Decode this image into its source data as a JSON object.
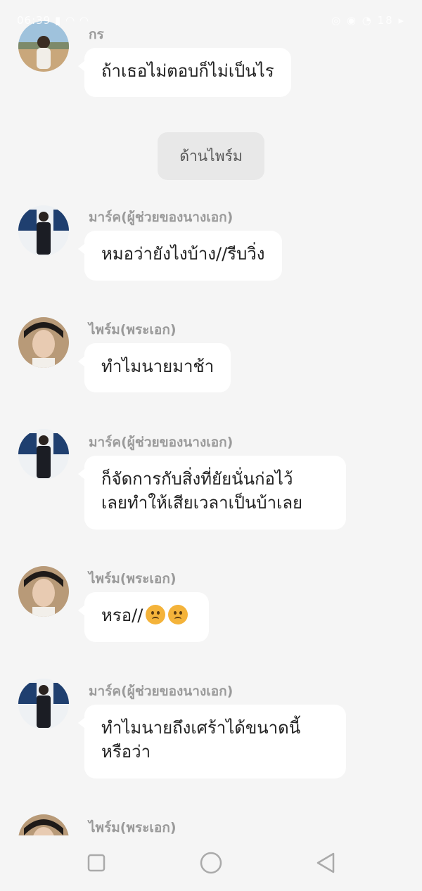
{
  "status_bar": {
    "left_text": "06:39 ▮ ◠ ◠",
    "right_text": "◎ ◉ ◔ 18 ▸"
  },
  "narration": {
    "label": "ด้านไพร์ม"
  },
  "messages": [
    {
      "sender": "กร",
      "text": "ถ้าเธอไม่ตอบก็ไม่เป็นไร"
    },
    {
      "sender": "มาร์ค(ผู้ช่วยของนางเอก)",
      "text": "หมอว่ายังไงบ้าง//รีบวิ่ง"
    },
    {
      "sender": "ไพร์ม(พระเอก)",
      "text": "ทำไมนายมาช้า"
    },
    {
      "sender": "มาร์ค(ผู้ช่วยของนางเอก)",
      "line1": "ก็จัดการกับสิ่งที่ยัยนั่นก่อไว้",
      "line2": "เลยทำให้เสียเวลาเป็นบ้าเลย"
    },
    {
      "sender": "ไพร์ม(พระเอก)",
      "text": "หรอ//",
      "emoji": "worried-face"
    },
    {
      "sender": "มาร์ค(ผู้ช่วยของนางเอก)",
      "line1": "ทำไมนายถึงเศร้าได้ขนาดนี้",
      "line2": "หรือว่า"
    },
    {
      "sender": "ไพร์ม(พระเอก)"
    }
  ],
  "nav": {
    "recent_icon": "square-icon",
    "home_icon": "circle-icon",
    "back_icon": "triangle-back-icon"
  },
  "colors": {
    "background": "#f5f5f5",
    "bubble": "#ffffff",
    "sender_name": "#9a9a9a",
    "narration_bg": "#e8e8e8",
    "text": "#222222"
  }
}
